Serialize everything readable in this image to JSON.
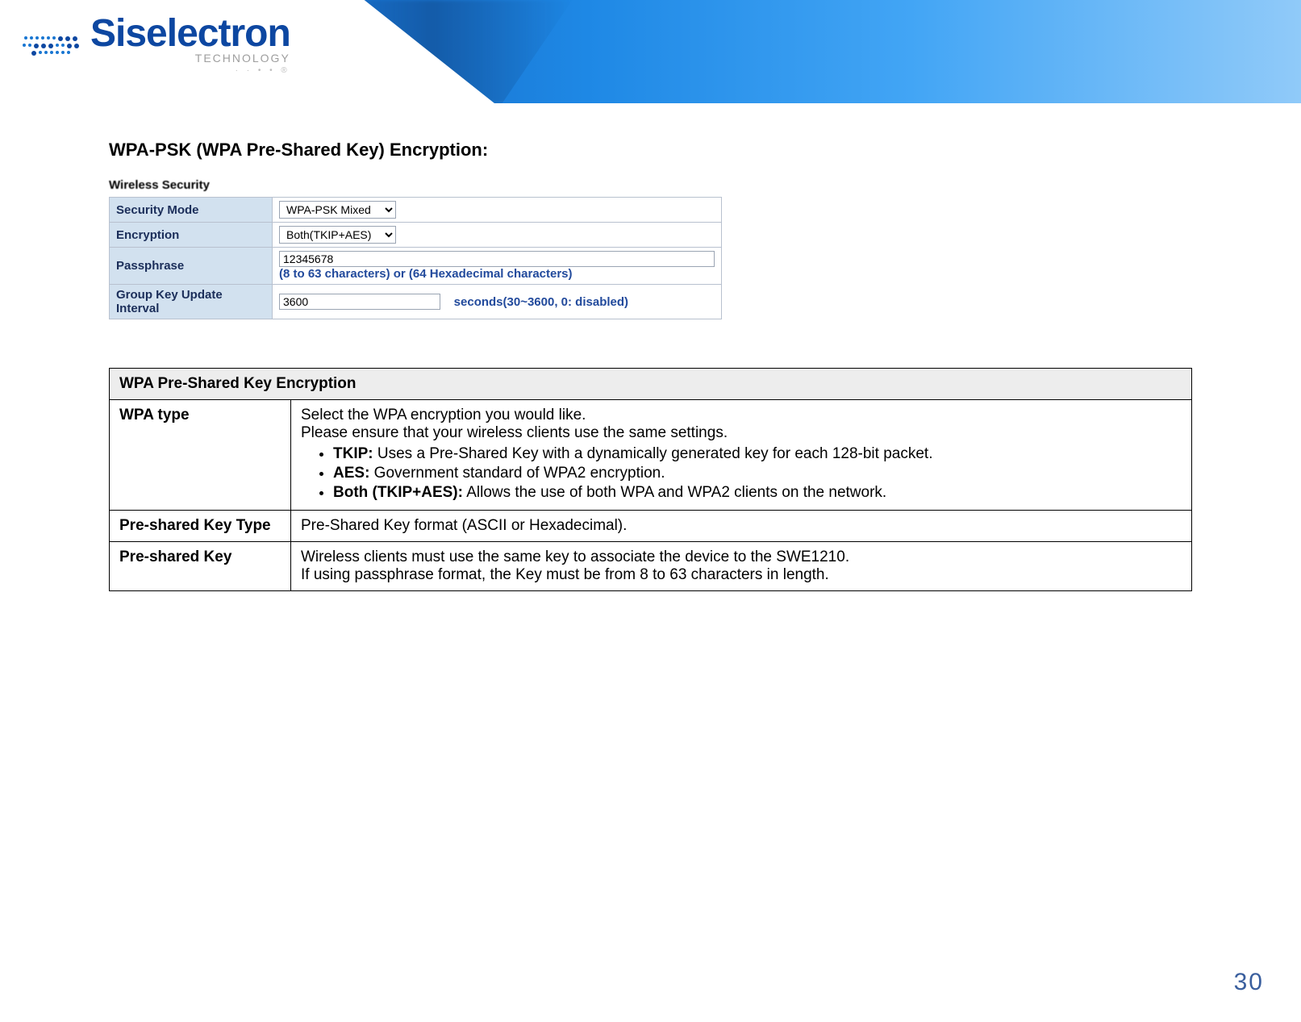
{
  "header": {
    "brand": "Siselectron",
    "tagline": "TECHNOLOGY",
    "tinytag": "· · • • ®"
  },
  "section_title": "WPA-PSK (WPA Pre-Shared Key) Encryption:",
  "screenshot": {
    "panel_title": "Wireless Security",
    "rows": {
      "security_mode": {
        "label": "Security Mode",
        "value": "WPA-PSK Mixed"
      },
      "encryption": {
        "label": "Encryption",
        "value": "Both(TKIP+AES)"
      },
      "passphrase": {
        "label": "Passphrase",
        "value": "12345678",
        "hint": "(8 to 63 characters) or (64 Hexadecimal characters)"
      },
      "group_key": {
        "label": "Group Key Update Interval",
        "value": "3600",
        "hint": "seconds(30~3600, 0: disabled)"
      }
    }
  },
  "desc_table": {
    "header": "WPA Pre-Shared Key Encryption",
    "rows": [
      {
        "key": "WPA type",
        "intro1": "Select the WPA encryption you would like.",
        "intro2": "Please ensure that your wireless clients use the same settings.",
        "bullets": [
          {
            "bold": "TKIP:",
            "text": " Uses a Pre-Shared Key with a dynamically generated key for each 128-bit packet."
          },
          {
            "bold": "AES:",
            "text": " Government standard of WPA2 encryption."
          },
          {
            "bold": "Both (TKIP+AES):",
            "text": " Allows the use of both WPA and WPA2 clients on the network."
          }
        ]
      },
      {
        "key": "Pre-shared Key Type",
        "text": "Pre-Shared Key format (ASCII or Hexadecimal)."
      },
      {
        "key": "Pre-shared Key",
        "line1": "Wireless clients must use the same key to associate the device to the SWE1210.",
        "line2": "If using passphrase format, the Key must be from 8 to 63 characters in length."
      }
    ]
  },
  "page_number": "30"
}
